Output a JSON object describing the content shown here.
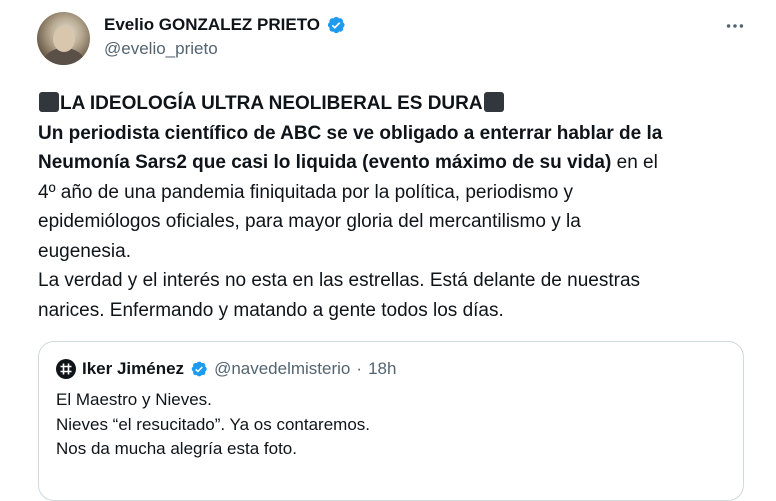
{
  "author": {
    "display_name": "Evelio GONZALEZ PRIETO",
    "handle": "@evelio_prieto"
  },
  "tweet": {
    "headline": "LA IDEOLOGÍA ULTRA NEOLIBERAL ES DURA",
    "bold_line_1": "Un periodista científico de ABC se ve obligado a enterrar hablar de la",
    "bold_line_2": "Neumonía Sars2 que casi lo liquida (evento máximo de su vida)",
    "line_2_rest": " en el",
    "line_3": "4º año de una pandemia finiquitada por la política, periodismo y",
    "line_4": "epidemiólogos oficiales, para mayor gloria del mercantilismo y la",
    "line_5": "eugenesia.",
    "line_6": "La verdad y el interés no esta en las estrellas. Está delante de nuestras",
    "line_7": "narices. Enfermando y matando a gente todos los días."
  },
  "quoted": {
    "display_name": "Iker Jiménez",
    "handle": "@navedelmisterio",
    "separator": "·",
    "time": "18h",
    "line_1": "El Maestro y Nieves.",
    "line_2": "Nieves “el resucitado”. Ya os contaremos.",
    "line_3": "Nos da mucha alegría esta foto."
  },
  "icons": {
    "verified": "verified-badge-icon",
    "more": "more-options-icon"
  },
  "colors": {
    "text": "#0f1419",
    "secondary": "#536471",
    "verified": "#1d9bf0",
    "border": "#cfd9de"
  }
}
